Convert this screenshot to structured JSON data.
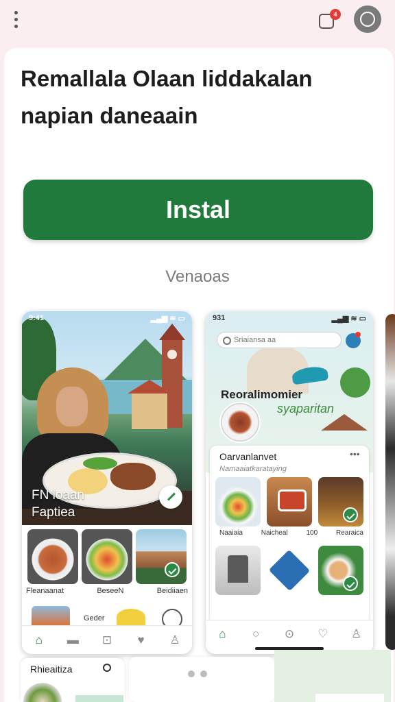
{
  "topbar": {
    "notification_count": "4",
    "icons": [
      "more-vert-icon",
      "notification-icon",
      "profile-icon"
    ]
  },
  "header": {
    "title_bold": "Remallala",
    "title_rest": " Olaan liddakalan napian daneaain"
  },
  "install": {
    "label": "Instal"
  },
  "subtitle": "Venaoas",
  "screenshots": {
    "first": {
      "status_left": "9:41",
      "status_right": "▂▄▆ ≋ ▭",
      "hero_caption_line1": "FN loaan",
      "hero_caption_line2": "Faptiea",
      "tiles": [
        "Fleanaanat",
        "BeseeN",
        "Beidiiaen"
      ],
      "row2_label": "Geder",
      "nav_icons": [
        "home-icon",
        "chat-icon",
        "info-icon",
        "heart-icon",
        "person-icon"
      ]
    },
    "second": {
      "status_left": "931",
      "status_right": "▂▄▆ ≋ ▭",
      "search_placeholder": "Sriaiansa aa",
      "brand_line1": "Reoralimomier",
      "brand_line2": "syaparitan",
      "card_title": "Oarvanlanvet",
      "card_subtitle": "Namaaiatkarataying",
      "card_more": "•••",
      "labels": [
        "Naaiaia",
        "Naicheal",
        "100",
        "Rearaica"
      ],
      "nav_icons": [
        "home-icon",
        "search-icon",
        "info-icon",
        "heart-icon",
        "person-icon"
      ]
    }
  },
  "bottom": {
    "card1_title": "Rhieaitiza"
  },
  "colors": {
    "accent": "#1f7a3c",
    "background": "#fbeef0"
  }
}
